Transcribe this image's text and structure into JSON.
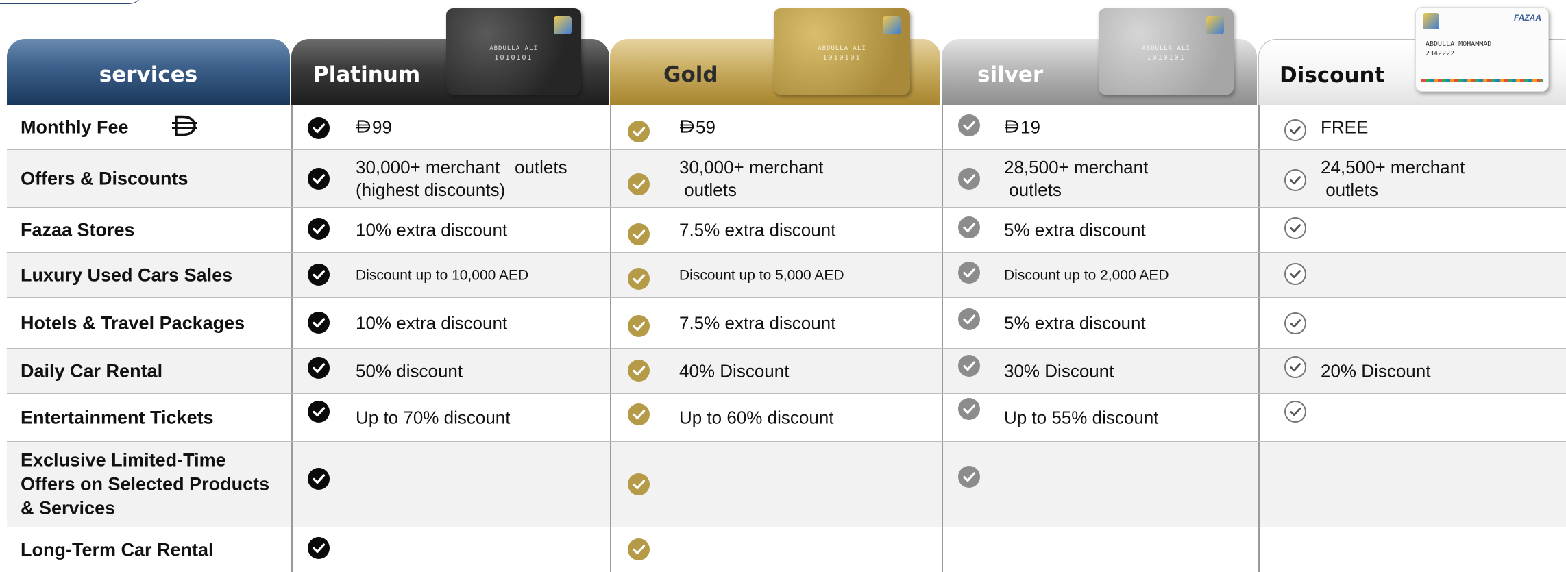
{
  "header": {
    "services": "services",
    "platinum": "Platinum",
    "gold": "Gold",
    "silver": "silver",
    "discount": "Discount"
  },
  "cards": {
    "platinum": {
      "holder": "ABDULLA ALI",
      "number": "1010101"
    },
    "gold": {
      "holder": "ABDULLA ALI",
      "number": "1010101"
    },
    "silver": {
      "holder": "ABDULLA ALI",
      "number": "1010101"
    },
    "discount": {
      "brand": "FAZAA",
      "holder": "ABDULLA MOHAMMAD",
      "number": "2342222"
    }
  },
  "icons": {
    "currency": "dirham-icon",
    "check": "check-icon"
  },
  "colors": {
    "services_header": "#1a385c",
    "platinum_check": "#0a0a0a",
    "gold_check": "#b59a48",
    "silver_check": "#8c8c8c",
    "discount_check": "#777777"
  },
  "rows": [
    {
      "service": "Monthly Fee",
      "platinum": "99",
      "gold": "59",
      "silver": "19",
      "discount": "FREE"
    },
    {
      "service": "Offers & Discounts",
      "platinum": "30,000+ merchant   outlets\n(highest discounts)",
      "gold": "30,000+ merchant\n outlets",
      "silver": "28,500+ merchant\n outlets",
      "discount": "24,500+ merchant\n outlets"
    },
    {
      "service": "Fazaa Stores",
      "platinum": "10% extra discount",
      "gold": "7.5% extra discount",
      "silver": "5% extra discount",
      "discount": ""
    },
    {
      "service": "Luxury Used Cars Sales",
      "platinum": "Discount up to 10,000 AED",
      "gold": "Discount up to 5,000 AED",
      "silver": "Discount up to 2,000 AED",
      "discount": ""
    },
    {
      "service": "Hotels & Travel Packages",
      "platinum": "10% extra discount",
      "gold": "7.5% extra discount",
      "silver": "5% extra discount",
      "discount": ""
    },
    {
      "service": "Daily Car Rental",
      "platinum": "50% discount",
      "gold": "40% Discount",
      "silver": "30% Discount",
      "discount": "20% Discount"
    },
    {
      "service": "Entertainment Tickets",
      "platinum": "Up to 70% discount",
      "gold": "Up to 60% discount",
      "silver": "Up to 55% discount",
      "discount": ""
    },
    {
      "service": "Exclusive Limited-Time Offers on Selected Products & Services",
      "platinum": "",
      "gold": "",
      "silver": "",
      "discount": ""
    },
    {
      "service": "Long-Term Car Rental",
      "platinum": "",
      "gold": "",
      "silver": "",
      "discount": ""
    }
  ]
}
